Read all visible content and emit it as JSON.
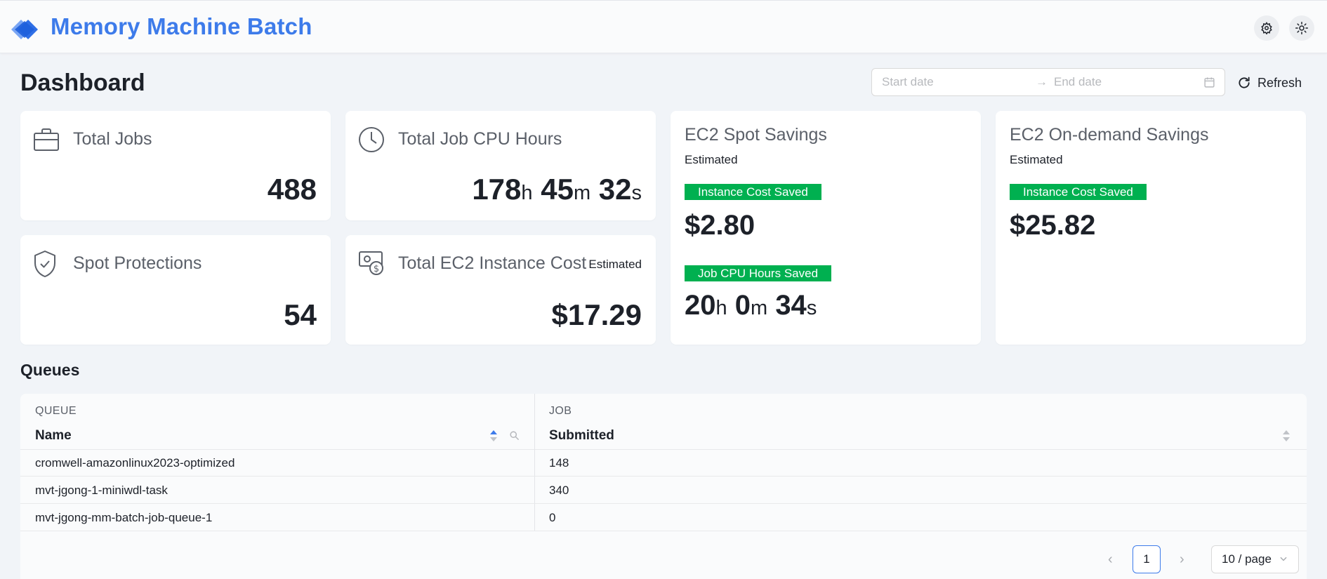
{
  "app": {
    "title": "Memory Machine Batch"
  },
  "header": {
    "settings_icon": "gear-icon",
    "theme_icon": "sun-icon"
  },
  "page": {
    "title": "Dashboard"
  },
  "filters": {
    "start_placeholder": "Start date",
    "end_placeholder": "End date",
    "arrow": "→",
    "refresh_label": "Refresh"
  },
  "cards": {
    "total_jobs": {
      "title": "Total Jobs",
      "value": "488",
      "icon": "briefcase-icon"
    },
    "cpu_hours": {
      "title": "Total Job CPU Hours",
      "icon": "clock-icon",
      "hours": "178",
      "minutes": "45",
      "seconds": "32",
      "h_unit": "h",
      "m_unit": "m",
      "s_unit": "s"
    },
    "spot_protections": {
      "title": "Spot Protections",
      "value": "54",
      "icon": "shield-check-icon"
    },
    "ec2_cost": {
      "title": "Total EC2 Instance Cost",
      "estimated": "Estimated",
      "value": "$17.29",
      "icon": "money-icon"
    },
    "spot_savings": {
      "title": "EC2 Spot Savings",
      "estimated": "Estimated",
      "cost_tag": "Instance Cost Saved",
      "cost_value": "$2.80",
      "cpu_tag": "Job CPU Hours Saved",
      "hours": "20",
      "minutes": "0",
      "seconds": "34",
      "h_unit": "h",
      "m_unit": "m",
      "s_unit": "s"
    },
    "ondemand_savings": {
      "title": "EC2 On-demand Savings",
      "estimated": "Estimated",
      "cost_tag": "Instance Cost Saved",
      "cost_value": "$25.82"
    }
  },
  "queues": {
    "title": "Queues",
    "group_queue": "QUEUE",
    "group_job": "JOB",
    "col_name": "Name",
    "col_submitted": "Submitted",
    "rows": [
      {
        "name": "cromwell-amazonlinux2023-optimized",
        "submitted": "148"
      },
      {
        "name": "mvt-jgong-1-miniwdl-task",
        "submitted": "340"
      },
      {
        "name": "mvt-jgong-mm-batch-job-queue-1",
        "submitted": "0"
      }
    ]
  },
  "pagination": {
    "prev": "‹",
    "next": "›",
    "current_page": "1",
    "page_size": "10 / page"
  },
  "colors": {
    "brand": "#3d7bea",
    "tag_green": "#00b050"
  }
}
